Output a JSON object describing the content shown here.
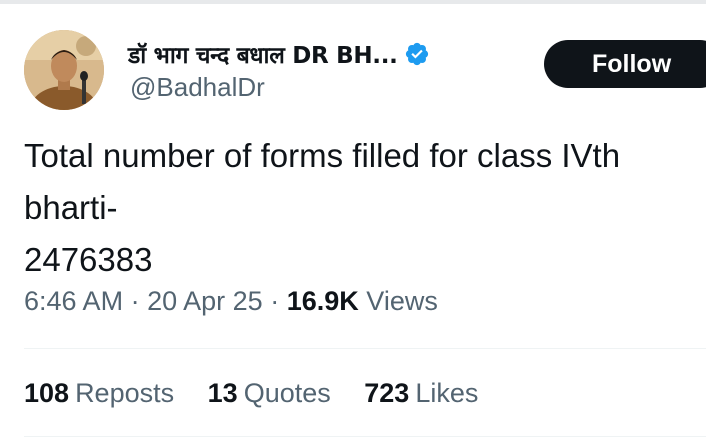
{
  "author": {
    "display_name": "डॉ भाग चन्द बधाल DR BH...",
    "handle": "@BadhalDr",
    "verified_icon": "verified-badge-icon",
    "verified_color": "#1d9bf0"
  },
  "follow_button": {
    "label": "Follow"
  },
  "tweet": {
    "lines": [
      "Total number of forms filled for class IVth",
      "bharti-",
      "2476383"
    ]
  },
  "meta": {
    "time": "6:46 AM",
    "separator": "·",
    "date": "20 Apr 25",
    "views_count": "16.9K",
    "views_label": "Views"
  },
  "stats": {
    "reposts": {
      "count": "108",
      "label": "Reposts"
    },
    "quotes": {
      "count": "13",
      "label": "Quotes"
    },
    "likes": {
      "count": "723",
      "label": "Likes"
    }
  },
  "colors": {
    "text_primary": "#0f1419",
    "text_secondary": "#536471",
    "button_bg": "#0f1419",
    "divider": "#eff3f4"
  }
}
